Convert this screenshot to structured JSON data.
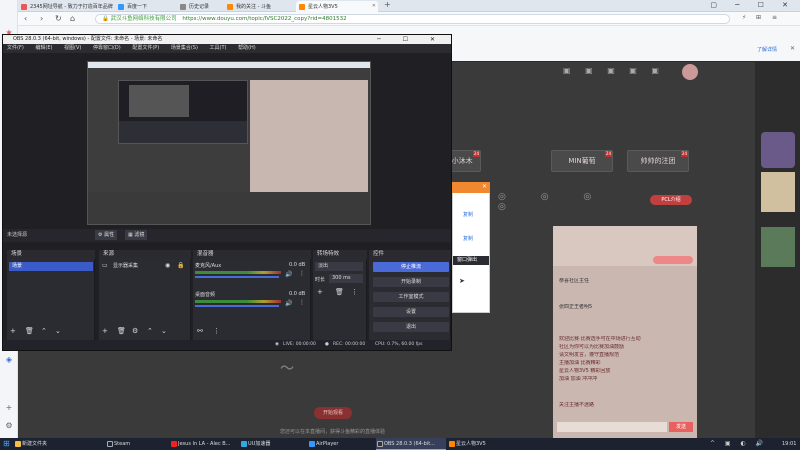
{
  "browser": {
    "tabs": [
      {
        "label": "2345网址导航 - 致力于打造百年品牌",
        "color": "#e55"
      },
      {
        "label": "百度一下",
        "color": "#39f"
      },
      {
        "label": "历史记录",
        "color": "#888"
      },
      {
        "label": "我的关注 - 斗鱼",
        "color": "#f80"
      },
      {
        "label": "星云人物3V5",
        "color": "#f80"
      }
    ],
    "url_secure": "武汉斗鱼网络科技有限公司",
    "url": "https://www.douyu.com/topic/IVSC2022_copy?rid=4801532",
    "learn_more": "了解详情"
  },
  "douyu": {
    "pills": [
      {
        "label": "• 小沐木",
        "badge": "24"
      },
      {
        "label": "MIN葡萄",
        "badge": "24"
      },
      {
        "label": "帅帅的注团",
        "badge": "24"
      }
    ],
    "pcl_label": "PCL介绍",
    "chat_lines": [
      "恭喜社区主任",
      "张四正王者明5",
      "欢迎比赛·比赛选手可在中场进行互动",
      "社区为你可以为比赛加油鼓励",
      "请文明发言，遵守直播规范",
      "主播加油 比赛精彩",
      "星云人物3V5 精彩回放",
      "加油 加油 冲冲冲",
      "关注主播不迷路"
    ],
    "send_label": "发送",
    "bottom_tip": "您还可以在本直播间，获得斗鱼精彩的直播体验",
    "bottom_button": "开始观看"
  },
  "obs": {
    "title": "OBS 28.0.3 (64-bit, windows) - 配置文件: 未命名 - 场景: 未命名",
    "menu": [
      "文件(F)",
      "编辑(E)",
      "视图(V)",
      "停靠窗口(D)",
      "配置文件(P)",
      "场景集合(S)",
      "工具(T)",
      "帮助(H)"
    ],
    "no_source": "未选择源",
    "props_label": "属性",
    "filters_label": "滤镜",
    "panels": {
      "scenes": "场景",
      "sources": "来源",
      "mixer": "混音器",
      "transitions": "转场特效",
      "controls": "控件"
    },
    "scene_item": "场景",
    "source_item": "显示器采集",
    "mixer": [
      {
        "name": "麦克风/Aux",
        "db": "0.0 dB"
      },
      {
        "name": "桌面音频",
        "db": "0.0 dB"
      }
    ],
    "transition": {
      "type": "淡出",
      "duration_label": "时长",
      "duration": "300 ms"
    },
    "controls": [
      "停止推流",
      "开始录制",
      "工作室模式",
      "设置",
      "退出"
    ],
    "status": {
      "live": "LIVE: 00:00:00",
      "rec": "REC: 00:00:00",
      "cpu": "CPU: 0.7%, 60.00 fps"
    }
  },
  "popup": {
    "items": [
      "复制",
      "复制",
      "窗口弹出"
    ],
    "label": "窗口弹出"
  },
  "taskbar": {
    "items": [
      {
        "label": "新建文件夹",
        "color": "#f4c04a"
      },
      {
        "label": "Steam",
        "color": "#1b2838"
      },
      {
        "label": "Jesus In LA - Alec B...",
        "color": "#e22"
      },
      {
        "label": "UU加速器",
        "color": "#3ad"
      },
      {
        "label": "AirPlayer",
        "color": "#39f"
      },
      {
        "label": "OBS 28.0.3 (64-bit...",
        "color": "#333"
      },
      {
        "label": "星云人物3V5",
        "color": "#f80"
      }
    ],
    "time": "19:01"
  }
}
